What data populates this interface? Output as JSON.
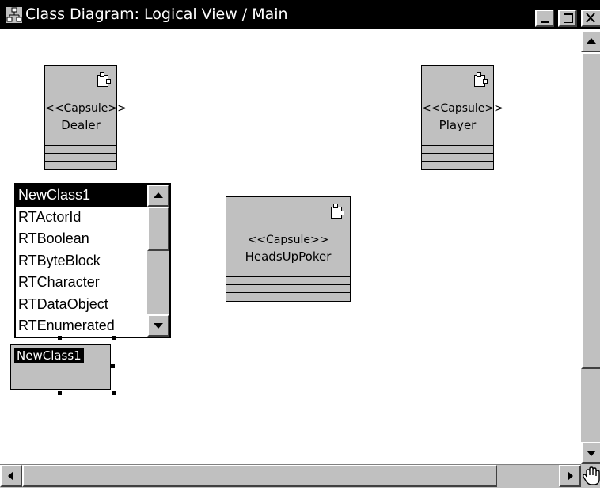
{
  "window": {
    "title": "Class Diagram: Logical View / Main",
    "icon": "class-diagram-icon"
  },
  "capsules": [
    {
      "stereotype": "<<Capsule>>",
      "name": "Dealer"
    },
    {
      "stereotype": "<<Capsule>>",
      "name": "Player"
    },
    {
      "stereotype": "<<Capsule>>",
      "name": "HeadsUpPoker"
    }
  ],
  "class_dropdown": {
    "items": [
      "NewClass1",
      "RTActorId",
      "RTBoolean",
      "RTByteBlock",
      "RTCharacter",
      "RTDataObject",
      "RTEnumerated"
    ],
    "selected": "NewClass1"
  },
  "new_class": {
    "name_edit_value": "NewClass1"
  },
  "colors": {
    "shape_fill": "#c0c0c0",
    "selection": "#000000",
    "titlebar": "#000000"
  }
}
